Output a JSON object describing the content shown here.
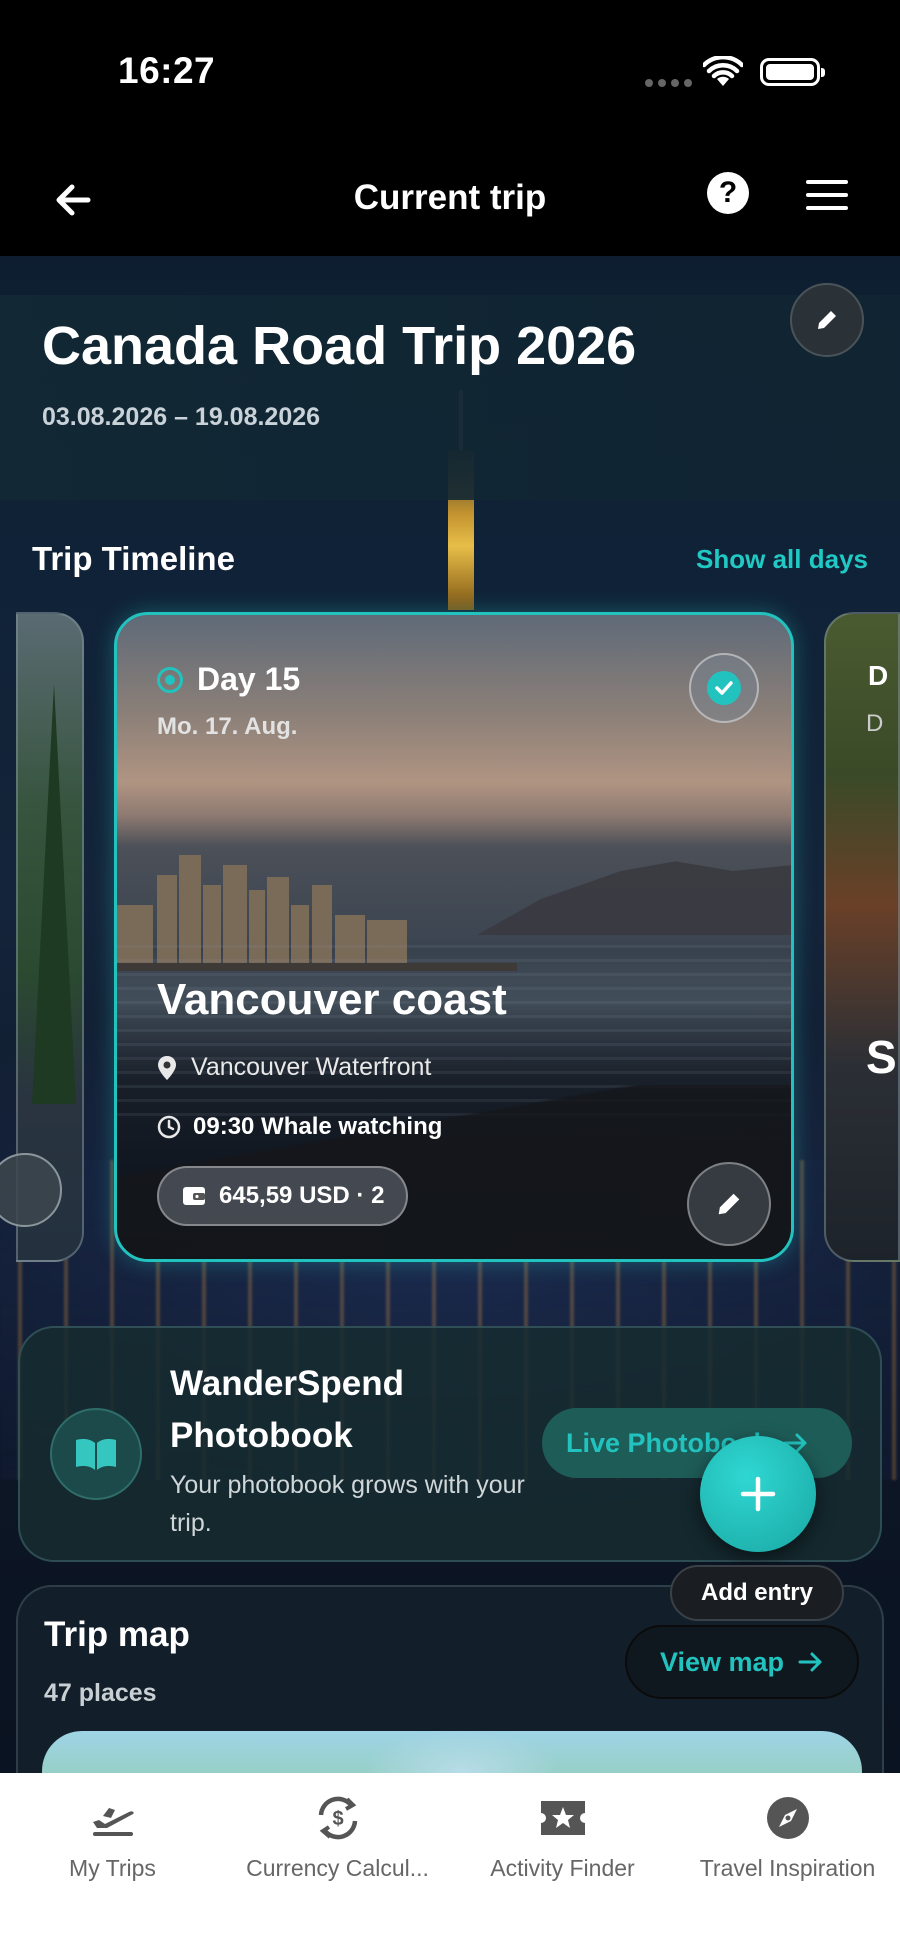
{
  "status": {
    "time": "16:27"
  },
  "nav": {
    "title": "Current trip"
  },
  "trip": {
    "title": "Canada Road Trip 2026",
    "dates": "03.08.2026 – 19.08.2026"
  },
  "timeline": {
    "heading": "Trip Timeline",
    "show_all": "Show all days",
    "current_day": {
      "label": "Day 15",
      "date": "Mo. 17. Aug.",
      "title": "Vancouver coast",
      "location": "Vancouver Waterfront",
      "activity": "09:30 Whale watching",
      "cost": "645,59 USD · 2",
      "completed": true
    },
    "next_day_peek": {
      "d1": "D",
      "d2": "D",
      "s": "S"
    }
  },
  "photobook": {
    "title": "WanderSpend Photobook",
    "subtitle": "Your photobook grows with your trip.",
    "live_button": "Live Photobook"
  },
  "fab": {
    "label": "Add entry"
  },
  "trip_map": {
    "title": "Trip map",
    "count": "47 places",
    "view_button": "View map"
  },
  "tabbar": [
    {
      "label": "My Trips",
      "icon": "airplane-departure-icon"
    },
    {
      "label": "Currency Calcul...",
      "icon": "currency-exchange-icon"
    },
    {
      "label": "Activity Finder",
      "icon": "ticket-star-icon"
    },
    {
      "label": "Travel Inspiration",
      "icon": "compass-icon"
    }
  ],
  "colors": {
    "accent": "#22c3bf",
    "background": "#000000",
    "tabbar": "#ffffff"
  }
}
